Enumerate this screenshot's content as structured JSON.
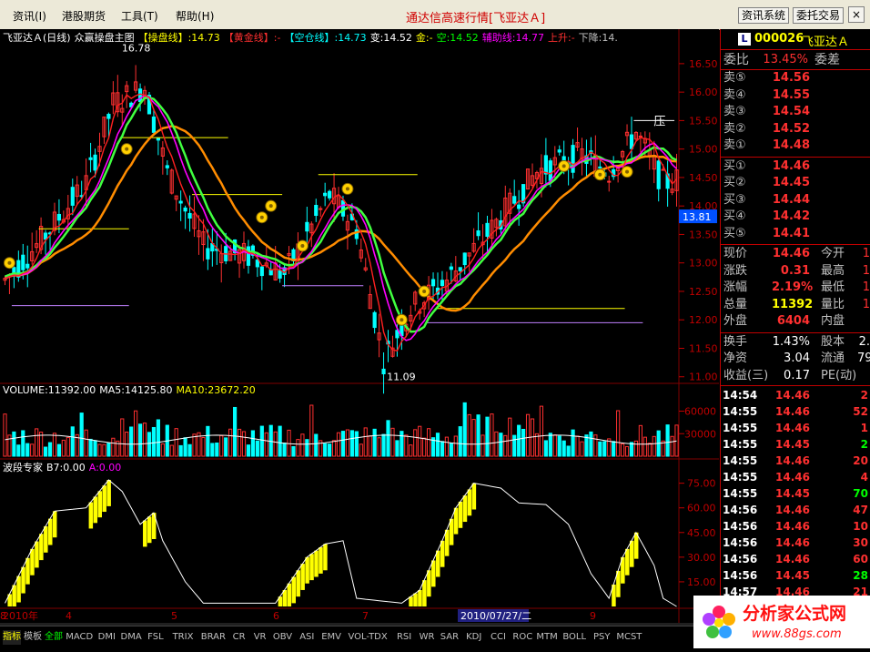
{
  "menu": {
    "items": [
      "资讯(I)",
      "港股期货",
      "工具(T)",
      "帮助(H)"
    ],
    "app_title": "通达信高速行情[飞亚达Ａ]",
    "btn_info": "资讯系统",
    "btn_trade": "委托交易",
    "ctl_min": "_",
    "ctl_max": "□",
    "ctl_close": "×"
  },
  "main_chart": {
    "header": [
      {
        "text": "飞亚达Ａ(日线)",
        "color": "#ffffff"
      },
      {
        "text": "众赢操盘主图",
        "color": "#ffffff"
      },
      {
        "text": "【操盘线】:14.73",
        "color": "#ffff00"
      },
      {
        "text": "【黄金线】:-",
        "color": "#ff3030"
      },
      {
        "text": "【空仓线】:14.73",
        "color": "#00ffff"
      },
      {
        "text": "变:14.52",
        "color": "#ffffff"
      },
      {
        "text": "金:-",
        "color": "#ffff00"
      },
      {
        "text": "空:14.52",
        "color": "#00ff00"
      },
      {
        "text": "辅助线:14.77",
        "color": "#ff00ff"
      },
      {
        "text": "上升:-",
        "color": "#ff3030"
      },
      {
        "text": "下降:14.",
        "color": "#c0c0c0"
      }
    ],
    "y_ticks": [
      "16.50",
      "16.00",
      "15.50",
      "15.00",
      "14.50",
      "14.00",
      "13.50",
      "13.00",
      "12.50",
      "12.00",
      "11.50",
      "11.00"
    ],
    "high_label": "16.78",
    "low_label": "11.09",
    "pressure_label": "压",
    "current_price_tag": "13.81"
  },
  "volume_chart": {
    "header": [
      {
        "text": "VOLUME:11392.00",
        "color": "#ffffff"
      },
      {
        "text": "MA5:14125.80",
        "color": "#ffffff"
      },
      {
        "text": "MA10:23672.20",
        "color": "#ffff00"
      }
    ],
    "y_ticks": [
      "60000",
      "30000"
    ]
  },
  "wave_chart": {
    "header": [
      {
        "text": "波段专家",
        "color": "#ffffff"
      },
      {
        "text": "B7:0.00",
        "color": "#ffffff"
      },
      {
        "text": "A:0.00",
        "color": "#ff00ff"
      }
    ],
    "y_ticks": [
      "75.00",
      "60.00",
      "45.00",
      "30.00",
      "15.00"
    ]
  },
  "x_axis": {
    "labels": [
      "2010年",
      "4",
      "5",
      "6",
      "7",
      "8",
      "9"
    ],
    "highlight": "2010/07/27/二"
  },
  "bottom_tabs": [
    "指标",
    "模板",
    "全部",
    "MACD",
    "DMI",
    "DMA",
    "FSL",
    "TRIX",
    "BRAR",
    "CR",
    "VR",
    "OBV",
    "ASI",
    "EMV",
    "VOL-TDX",
    "RSI",
    "WR",
    "SAR",
    "KDJ",
    "CCI",
    "ROC",
    "MTM",
    "BOLL",
    "PSY",
    "MCST"
  ],
  "quote": {
    "code": "000026",
    "name": "飞亚达Ａ",
    "badge": "L",
    "weibi_label": "委比",
    "weibi_value": "13.45%",
    "weicha_label": "委差",
    "sells": [
      {
        "label": "卖⑤",
        "price": "14.56"
      },
      {
        "label": "卖④",
        "price": "14.55"
      },
      {
        "label": "卖③",
        "price": "14.54"
      },
      {
        "label": "卖②",
        "price": "14.52"
      },
      {
        "label": "卖①",
        "price": "14.48"
      }
    ],
    "buys": [
      {
        "label": "买①",
        "price": "14.46"
      },
      {
        "label": "买②",
        "price": "14.45"
      },
      {
        "label": "买③",
        "price": "14.44"
      },
      {
        "label": "买④",
        "price": "14.42"
      },
      {
        "label": "买⑤",
        "price": "14.41"
      }
    ],
    "stats": [
      {
        "l1": "现价",
        "v1": "14.46",
        "c1": "#ff3030",
        "l2": "今开",
        "v2": "1"
      },
      {
        "l1": "涨跌",
        "v1": "0.31",
        "c1": "#ff3030",
        "l2": "最高",
        "v2": "1"
      },
      {
        "l1": "涨幅",
        "v1": "2.19%",
        "c1": "#ff3030",
        "l2": "最低",
        "v2": "1"
      },
      {
        "l1": "总量",
        "v1": "11392",
        "c1": "#ffff00",
        "l2": "量比",
        "v2": "1"
      },
      {
        "l1": "外盘",
        "v1": "6404",
        "c1": "#ff3030",
        "l2": "内盘",
        "v2": ""
      }
    ],
    "finance": [
      {
        "l1": "换手",
        "v1": "1.43%",
        "l2": "股本",
        "v2": "2."
      },
      {
        "l1": "净资",
        "v1": "3.04",
        "l2": "流通",
        "v2": "79"
      },
      {
        "l1": "收益(三)",
        "v1": "0.17",
        "l2": "PE(动)",
        "v2": ""
      }
    ],
    "ticks": [
      {
        "time": "14:54",
        "price": "14.46",
        "vol": "2",
        "pc": "#ff3030",
        "vc": "#ff3030"
      },
      {
        "time": "14:55",
        "price": "14.46",
        "vol": "52",
        "pc": "#ff3030",
        "vc": "#ff3030"
      },
      {
        "time": "14:55",
        "price": "14.46",
        "vol": "1",
        "pc": "#ff3030",
        "vc": "#ff3030"
      },
      {
        "time": "14:55",
        "price": "14.45",
        "vol": "2",
        "pc": "#ff3030",
        "vc": "#00ff00"
      },
      {
        "time": "14:55",
        "price": "14.46",
        "vol": "20",
        "pc": "#ff3030",
        "vc": "#ff3030"
      },
      {
        "time": "14:55",
        "price": "14.46",
        "vol": "4",
        "pc": "#ff3030",
        "vc": "#ff3030"
      },
      {
        "time": "14:55",
        "price": "14.45",
        "vol": "70",
        "pc": "#ff3030",
        "vc": "#00ff00"
      },
      {
        "time": "14:56",
        "price": "14.46",
        "vol": "47",
        "pc": "#ff3030",
        "vc": "#ff3030"
      },
      {
        "time": "14:56",
        "price": "14.46",
        "vol": "10",
        "pc": "#ff3030",
        "vc": "#ff3030"
      },
      {
        "time": "14:56",
        "price": "14.46",
        "vol": "30",
        "pc": "#ff3030",
        "vc": "#ff3030"
      },
      {
        "time": "14:56",
        "price": "14.46",
        "vol": "60",
        "pc": "#ff3030",
        "vc": "#ff3030"
      },
      {
        "time": "14:56",
        "price": "14.45",
        "vol": "28",
        "pc": "#ff3030",
        "vc": "#00ff00"
      },
      {
        "time": "14:57",
        "price": "14.46",
        "vol": "21",
        "pc": "#ff3030",
        "vc": "#ff3030"
      }
    ]
  },
  "watermark": {
    "text1": "分析家公式网",
    "text2": "www.88gs.com"
  },
  "colors": {
    "up": "#ff3030",
    "down": "#00ffff",
    "grid": "#800000",
    "axis_text": "#c00000",
    "ma_red": "#ff2020",
    "ma_magenta": "#ff00ff",
    "ma_orange": "#ff8c00",
    "ma_green": "#40ff40",
    "wave_yellow": "#ffff00"
  }
}
